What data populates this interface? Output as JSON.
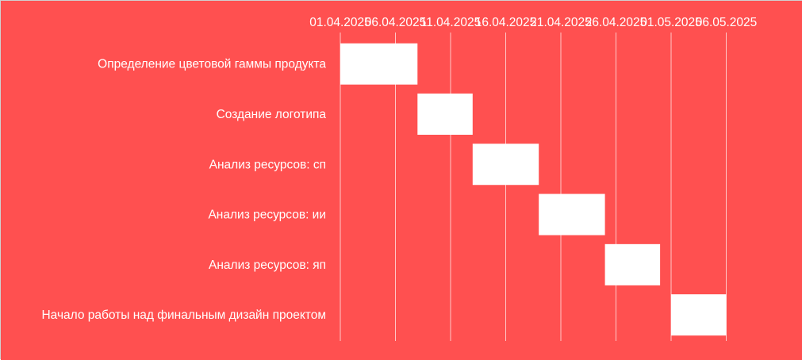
{
  "chart_data": {
    "type": "bar",
    "orientation": "gantt",
    "background_color": "#FF5050",
    "bar_color": "#FFFFFF",
    "grid_color": "#FFFFFF",
    "grid": true,
    "x_axis_position": "top",
    "xlim": [
      "2025-04-01",
      "2025-05-11"
    ],
    "x_ticks": [
      "01.04.2025",
      "06.04.2025",
      "11.04.2025",
      "16.04.2025",
      "21.04.2025",
      "26.04.2025",
      "01.05.2025",
      "06.05.2025"
    ],
    "tasks": [
      {
        "label": "Определение цветовой гаммы продукта",
        "start": "2025-04-01",
        "end": "2025-04-08"
      },
      {
        "label": "Создание логотипа",
        "start": "2025-04-08",
        "end": "2025-04-13"
      },
      {
        "label": "Анализ ресурсов: сп",
        "start": "2025-04-13",
        "end": "2025-04-19"
      },
      {
        "label": "Анализ ресурсов: ии",
        "start": "2025-04-19",
        "end": "2025-04-25"
      },
      {
        "label": "Анализ ресурсов: яп",
        "start": "2025-04-25",
        "end": "2025-04-30"
      },
      {
        "label": "Начало работы над финальным дизайн проектом",
        "start": "2025-05-01",
        "end": "2025-05-06"
      }
    ]
  }
}
